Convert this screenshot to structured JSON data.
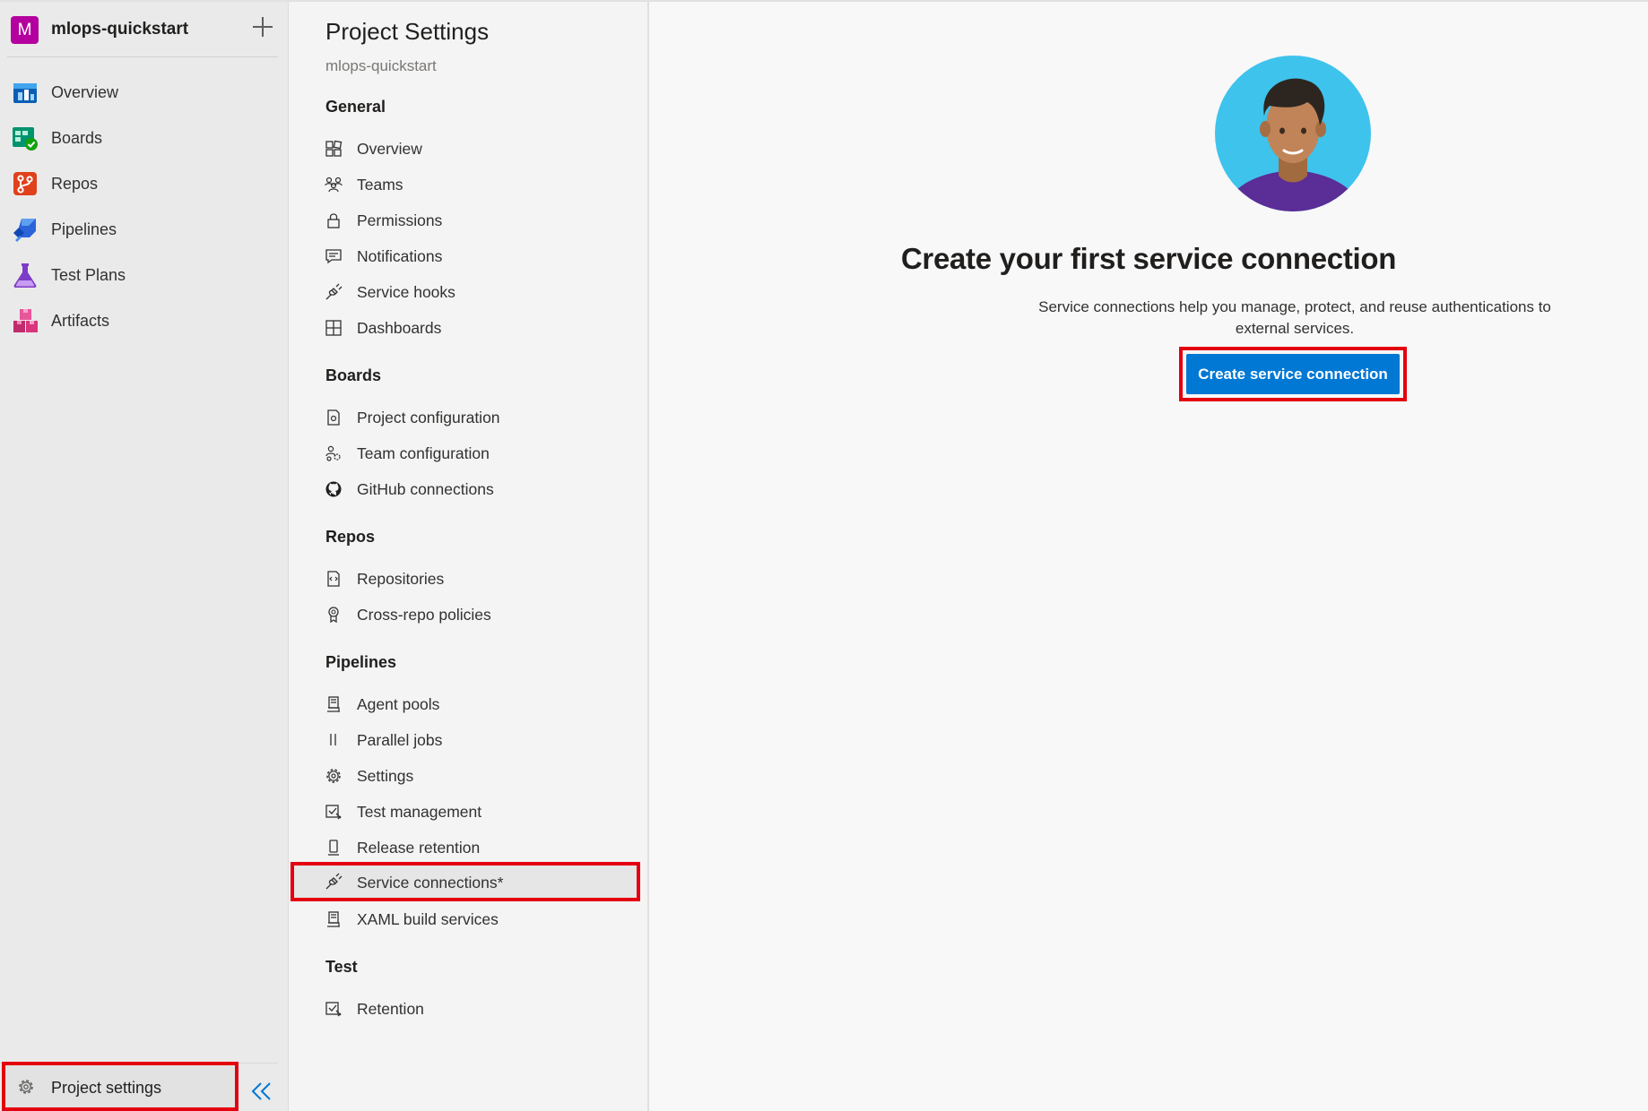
{
  "project": {
    "badge_letter": "M",
    "name": "mlops-quickstart",
    "badge_color": "#b4009e"
  },
  "left_nav": {
    "items": [
      {
        "label": "Overview",
        "icon": "overview-icon"
      },
      {
        "label": "Boards",
        "icon": "boards-icon"
      },
      {
        "label": "Repos",
        "icon": "repos-icon"
      },
      {
        "label": "Pipelines",
        "icon": "pipelines-icon"
      },
      {
        "label": "Test Plans",
        "icon": "test-plans-icon"
      },
      {
        "label": "Artifacts",
        "icon": "artifacts-icon"
      }
    ],
    "project_settings_label": "Project settings"
  },
  "settings": {
    "title": "Project Settings",
    "subtitle": "mlops-quickstart",
    "sections": [
      {
        "header": "General",
        "items": [
          {
            "label": "Overview",
            "icon": "grid-icon"
          },
          {
            "label": "Teams",
            "icon": "people-icon"
          },
          {
            "label": "Permissions",
            "icon": "lock-icon"
          },
          {
            "label": "Notifications",
            "icon": "chat-icon"
          },
          {
            "label": "Service hooks",
            "icon": "plug-icon"
          },
          {
            "label": "Dashboards",
            "icon": "dashboard-icon"
          }
        ]
      },
      {
        "header": "Boards",
        "items": [
          {
            "label": "Project configuration",
            "icon": "document-settings-icon"
          },
          {
            "label": "Team configuration",
            "icon": "team-settings-icon"
          },
          {
            "label": "GitHub connections",
            "icon": "github-icon"
          }
        ]
      },
      {
        "header": "Repos",
        "items": [
          {
            "label": "Repositories",
            "icon": "repo-doc-icon"
          },
          {
            "label": "Cross-repo policies",
            "icon": "ribbon-icon"
          }
        ]
      },
      {
        "header": "Pipelines",
        "items": [
          {
            "label": "Agent pools",
            "icon": "server-icon"
          },
          {
            "label": "Parallel jobs",
            "icon": "parallel-icon"
          },
          {
            "label": "Settings",
            "icon": "gear-icon"
          },
          {
            "label": "Test management",
            "icon": "test-management-icon"
          },
          {
            "label": "Release retention",
            "icon": "phone-icon"
          },
          {
            "label": "Service connections*",
            "icon": "plug-icon",
            "selected": true
          },
          {
            "label": "XAML build services",
            "icon": "server-icon"
          }
        ]
      },
      {
        "header": "Test",
        "items": [
          {
            "label": "Retention",
            "icon": "test-management-icon"
          }
        ]
      }
    ]
  },
  "main": {
    "title": "Create your first service connection",
    "description": "Service connections help you manage, protect, and reuse authentications to external services.",
    "button_label": "Create service connection"
  },
  "colors": {
    "accent": "#0078d4",
    "highlight": "#e4000f"
  }
}
